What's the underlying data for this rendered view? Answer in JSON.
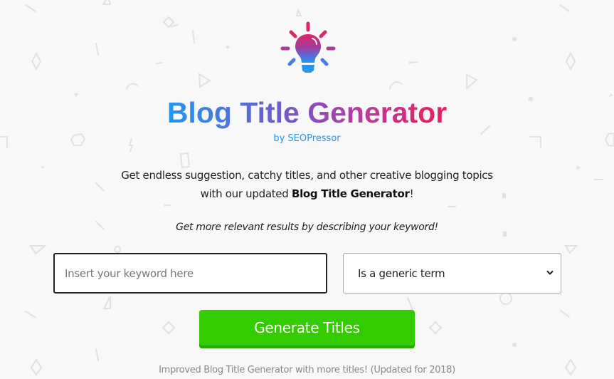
{
  "header": {
    "icon": "lightbulb-icon",
    "title": "Blog Title Generator",
    "byline_prefix": "by ",
    "byline_link": "SEOPressor"
  },
  "intro": {
    "line1": "Get endless suggestion, catchy titles, and other creative blogging topics",
    "line2_prefix": "with our updated ",
    "line2_bold": "Blog Title Generator",
    "line2_suffix": "!"
  },
  "hint": "Get more relevant results by describing your keyword!",
  "form": {
    "keyword_placeholder": "Insert your keyword here",
    "keyword_value": "",
    "type_select": {
      "selected": "Is a generic term",
      "icon": "chevron-down-icon"
    },
    "generate_label": "Generate Titles"
  },
  "footer_note": "Improved Blog Title Generator with more titles! (Updated for 2018)",
  "colors": {
    "background": "#f8f8f8",
    "title_gradient_start": "#2196f3",
    "title_gradient_end": "#ea1e5c",
    "byline": "#2196f3",
    "button": "#33cc00",
    "button_shadow": "#2aa800"
  }
}
